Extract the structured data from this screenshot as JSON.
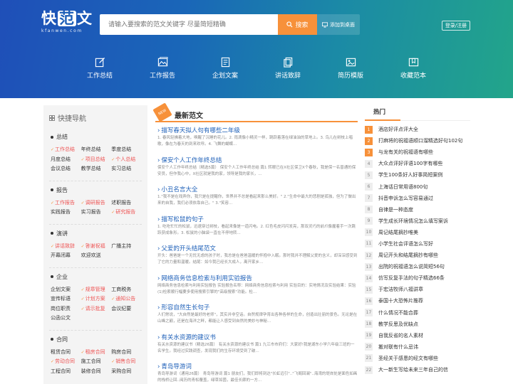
{
  "header": {
    "logo_chars": [
      "快",
      "范",
      "文"
    ],
    "logo_sub": "kfanwen.com",
    "search_placeholder": "请输入要搜索的范文关键字 尽量简短精确",
    "search_button": "搜索",
    "desktop_button": "添加到桌面",
    "login": "登录/注册"
  },
  "nav": [
    {
      "label": "工作总结",
      "icon": "edit-icon"
    },
    {
      "label": "工作报告",
      "icon": "image-icon"
    },
    {
      "label": "企划文案",
      "icon": "document-icon"
    },
    {
      "label": "讲话致辞",
      "icon": "copy-icon"
    },
    {
      "label": "简历模版",
      "icon": "picture-icon"
    },
    {
      "label": "收藏范本",
      "icon": "bookmark-icon"
    }
  ],
  "sidebar": {
    "title": "快捷导航",
    "categories": [
      {
        "name": "总结",
        "links": [
          {
            "t": "工作总结",
            "hot": true
          },
          {
            "t": "年终总结"
          },
          {
            "t": "季度总结"
          },
          {
            "t": "月度总结"
          },
          {
            "t": "项目总结",
            "hot": true
          },
          {
            "t": "个人总结",
            "hot": true
          },
          {
            "t": "会议总结"
          },
          {
            "t": "教学总结"
          },
          {
            "t": "实习总结"
          }
        ]
      },
      {
        "name": "报告",
        "links": [
          {
            "t": "工作报告",
            "hot": true
          },
          {
            "t": "调研报告",
            "hot": true
          },
          {
            "t": "述职报告"
          },
          {
            "t": "实践报告"
          },
          {
            "t": "实习报告"
          },
          {
            "t": "研究报告",
            "hot": true
          }
        ]
      },
      {
        "name": "演讲",
        "links": [
          {
            "t": "讲话致辞",
            "hot": true
          },
          {
            "t": "答谢祝福",
            "hot": true
          },
          {
            "t": "广播主持"
          },
          {
            "t": "开幕闭幕"
          },
          {
            "t": "欢迎欢送"
          }
        ]
      },
      {
        "name": "企业",
        "links": [
          {
            "t": "企划文案"
          },
          {
            "t": "规章管理",
            "hot": true
          },
          {
            "t": "工商税务"
          },
          {
            "t": "宣传标语"
          },
          {
            "t": "计划方案",
            "hot": true
          },
          {
            "t": "通知公告",
            "hot": true
          },
          {
            "t": "岗位职责"
          },
          {
            "t": "请示批复",
            "hot": true
          },
          {
            "t": "会议纪要"
          },
          {
            "t": "公函公文"
          }
        ]
      },
      {
        "name": "合同",
        "links": [
          {
            "t": "租赁合同"
          },
          {
            "t": "租房合同",
            "hot": true
          },
          {
            "t": "购房合同"
          },
          {
            "t": "劳动合同",
            "hot": true
          },
          {
            "t": "施工合同"
          },
          {
            "t": "销售合同",
            "hot": true
          },
          {
            "t": "工程合同"
          },
          {
            "t": "装修合同"
          },
          {
            "t": "采购合同"
          }
        ]
      }
    ]
  },
  "main": {
    "badge": "NEW",
    "title": "最新范文",
    "articles": [
      {
        "title": "描写春天拟人句有哪些二年级",
        "snippet": "1. 春风轻拂着大地，唤醒了沉睡的花儿。2. 雨滴像小精灵一样，跳跃着落在绿油油的草地上。3. 鸟儿在树枝上唱歌，像在为春天的到来欢呼。4. 飞舞的蝴蝶..."
      },
      {
        "title": "保安个人工作年终总结",
        "snippet": "保安个人工作年终总结（精选5篇） 保安个人工作年终总结 篇1 转眼已在X社区保卫X个春秋，我是保一名普通的保安员，但作我心中，X社区就是我的家，领导是我的家长，..."
      },
      {
        "title": "小丑名言大全",
        "snippet": "1.\"我不是在戏弄你，我只是在提醒你，世界并不总是看起来那么美好。\" 2.\"生命中最大的悲剧是孤独，但为了做出来的自我，我们必须依靠自己。\" 3.\"笑容..."
      },
      {
        "title": "描写松鼠的句子",
        "snippet": "1. 吃吃忙忙的松鼠，迅速穿过树枝，看起来像是一道闪电。2. 红色毛皮闪闪发亮，那双灵巧的前爪像握着手一次跳跃获成象形。3. 松鼠的小脑袋一直在不停地转..."
      },
      {
        "title": "父爱的开头结尾范文",
        "snippet": "开头：爸爸是一个无忧无虑的孩子时，我总是在爸爸温暖的怀抱中入眠。那时我并不理解父爱的含义，却深深感受到了它的力量和温暖。结尾：如今我已经长大成人，离开家乡..."
      },
      {
        "title": "网络商务信息检索与利用实验报告",
        "snippet": "网络商务信息检索与利用实验报告 实验报告名称：网络商务信息检索与利用 实验目的：实地情况及实验结果：实验(1)检索顺行幅要多使用搜索引擎的\"高级搜索\"功能。检..."
      },
      {
        "title": "形容自然生长句子",
        "snippet": "人们常说，\"大自然是最好的老师\"，其实并非空话。自然规律孕育出各种各样的生命，创造出壮丽的景色。无论是在山峰之巅，还是在海洋之畔，都能让人感受到自然的美妙与神秘..."
      },
      {
        "title": "有关水资源的建议书",
        "snippet": "有关水资源的建议书（精选26篇） 有关水资源的建议书 篇1 九江市市府们：大家好!我是湖东小学六年级三班的一名学生。我经过实践调查，发现我们的生存环境受到了破..."
      },
      {
        "title": "青岛导游词",
        "snippet": "青岛导游词（通用26篇） 青岛导游词 篇1 朋友们，我们即将到达\"长虹远引\"..\"飞阁回澜\"..海湾的堤岸处是面色如画的栈桥让回..阅历的青松覆盖，绿草如茵，最佳长廊的一方..."
      }
    ]
  },
  "hot": {
    "title": "热门",
    "items": [
      "酒店好评点评大全",
      "打麻将的祝福语顺口溜精选好句102句",
      "与龙有关的祝福语有哪些",
      "大众点评好评语100字有哪些",
      "学生100条好人好事简短案例",
      "上海话日常用语800句",
      "抖音申诉怎么写容易通过",
      "自律是一种态度",
      "学生成长环境情况怎么填写案诉",
      "周记结尾摘抄唯美",
      "小学生社会评语怎么写好",
      "周记开头和结尾摘抄有哪些",
      "出院的祝福语怎么说简短56句",
      "仿写反复手法的句子精选66条",
      "于宏洁牧师八福讲章",
      "泰国十大恐怖片推荐",
      "什么情况不能合葬",
      "教学反思及优缺点",
      "自我反省的名人素材",
      "搬对联有什么忌讳",
      "圣经关于感恩的经文有哪些",
      "大一新生写给未来三年自己的信"
    ]
  },
  "colors": {
    "accent": "#f7913a",
    "link": "#1d5fb8",
    "hot": "#e55555"
  }
}
